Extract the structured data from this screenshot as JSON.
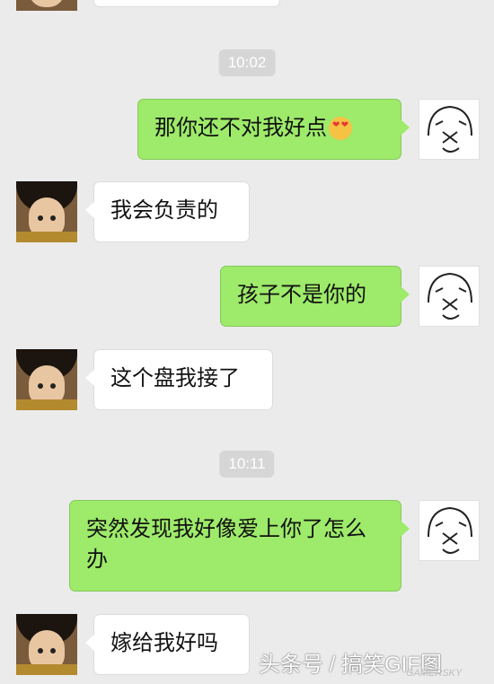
{
  "timestamps": [
    "10:02",
    "10:11"
  ],
  "messages": [
    {
      "text": "那你还不对我好点",
      "emoji": "heart-eyes"
    },
    {
      "text": "我会负责的"
    },
    {
      "text": "孩子不是你的"
    },
    {
      "text": "这个盘我接了"
    },
    {
      "text": "突然发现我好像爱上你了怎么办"
    },
    {
      "text": "嫁给我好吗"
    }
  ],
  "watermark": "头条号 / 搞笑GIF图",
  "watermark_small": "GAMERSKY",
  "colors": {
    "background": "#ebebeb",
    "sent_bubble": "#9eea6a",
    "received_bubble": "#ffffff",
    "timestamp_bg": "#d6d6d6"
  }
}
